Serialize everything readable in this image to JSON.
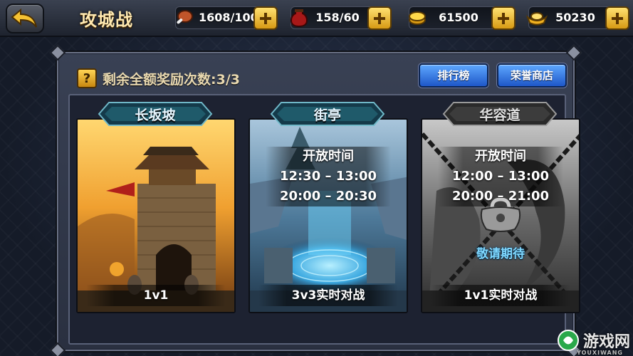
{
  "header": {
    "title": "攻城战"
  },
  "resources": [
    {
      "icon": "meat-icon",
      "value": "1608/100"
    },
    {
      "icon": "wine-jar-icon",
      "value": "158/60"
    },
    {
      "icon": "coin-icon",
      "value": "61500"
    },
    {
      "icon": "gold-ingot-icon",
      "value": "50230"
    }
  ],
  "panel": {
    "help_symbol": "?",
    "remaining_text": "剩余全额奖励次数:3/3",
    "ranking_label": "排行榜",
    "shop_label": "荣誉商店"
  },
  "cards": [
    {
      "name": "长坂坡",
      "mode": "1v1"
    },
    {
      "name": "街亭",
      "open_label": "开放时间",
      "times": [
        "12:30 – 13:00",
        "20:00 – 20:30"
      ],
      "mode": "3v3实时对战"
    },
    {
      "name": "华容道",
      "open_label": "开放时间",
      "times": [
        "12:00 – 13:00",
        "20:00 – 21:00"
      ],
      "status": "敬请期待",
      "mode": "1v1实时对战"
    }
  ],
  "watermark": {
    "text": "游戏网",
    "sub": "YOUXIWANG"
  },
  "colors": {
    "accent_gold": "#ffd455",
    "button_blue": "#1e57c8",
    "status_cyan": "#7fd8ff"
  }
}
